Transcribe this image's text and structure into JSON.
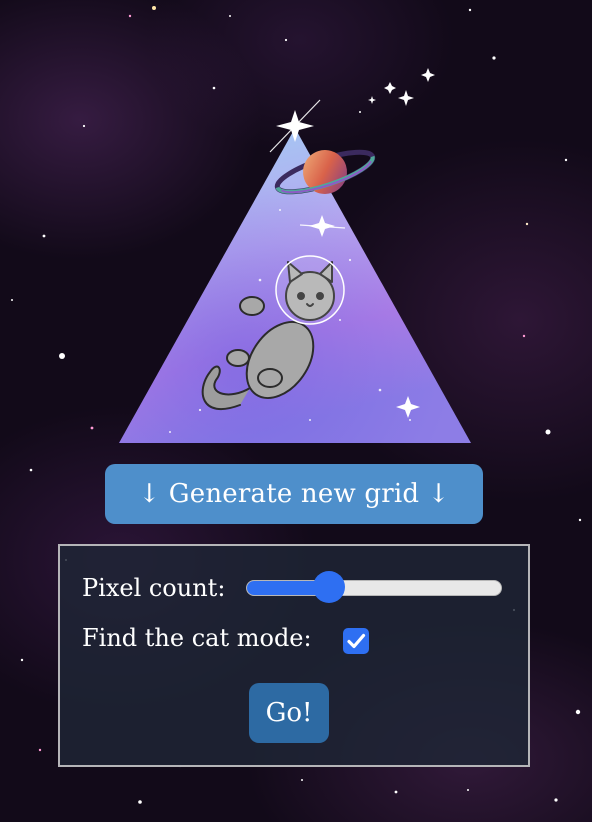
{
  "generate_button": {
    "label": "↓ Generate new grid ↓"
  },
  "settings": {
    "pixel_count_label": "Pixel count:",
    "pixel_count_value": 0.3,
    "find_cat_label": "Find the cat mode:",
    "find_cat_checked": true,
    "go_label": "Go!"
  },
  "colors": {
    "accent": "#2e6ff2",
    "generate_button_bg": "#4e8fcb",
    "go_button_bg": "#2d6aa3",
    "background": "#120a19"
  },
  "hero": {
    "icon": "space-cat-triangle-logo"
  }
}
